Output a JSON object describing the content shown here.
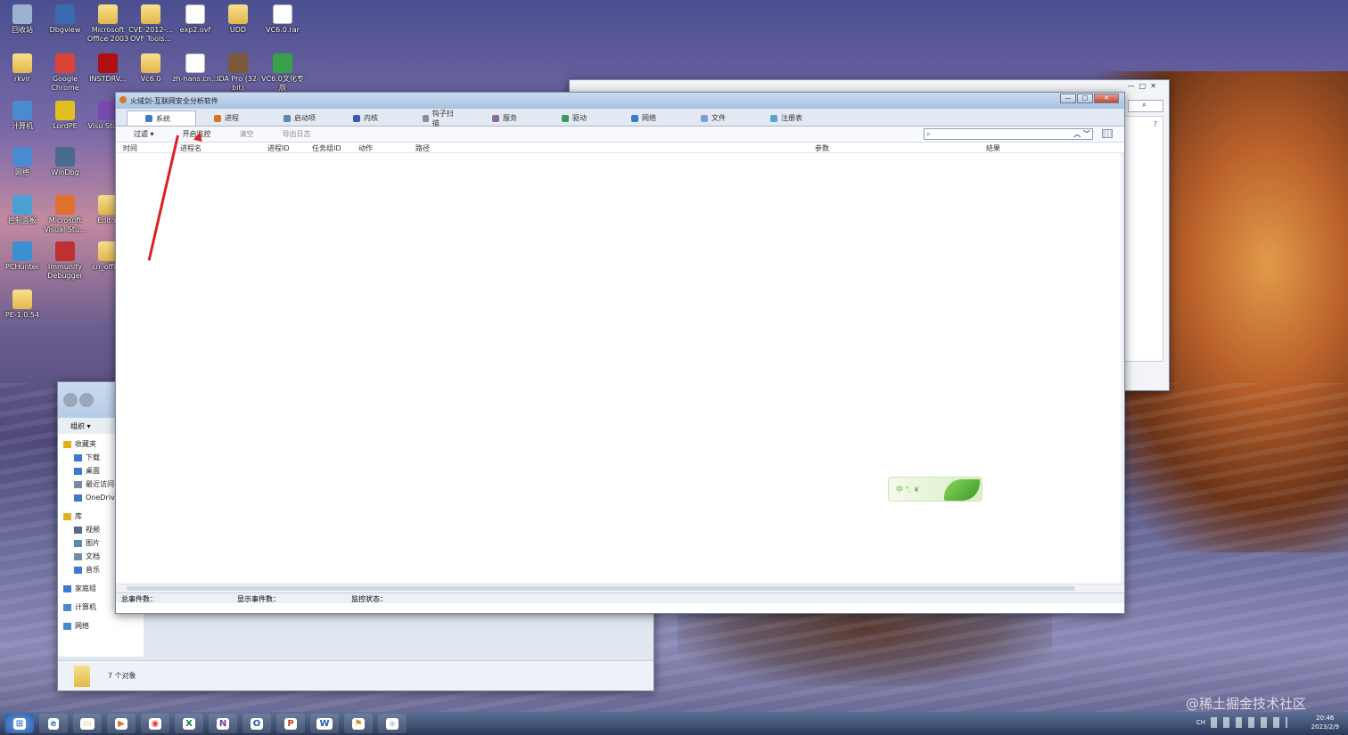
{
  "desktop": {
    "icons": [
      {
        "label": "回收站",
        "kind": "app",
        "color": "#9bb3d0"
      },
      {
        "label": "Dbgview",
        "kind": "app",
        "color": "#3a6ab0"
      },
      {
        "label": "Microsoft Office 2003",
        "kind": "folder",
        "color": "#e2b84a"
      },
      {
        "label": "CVE-2012-... OVF Tools...",
        "kind": "folder",
        "color": "#e2b84a"
      },
      {
        "label": "exp2.ovf",
        "kind": "file",
        "color": "#ffffff"
      },
      {
        "label": "UDD",
        "kind": "folder",
        "color": "#e2b84a"
      },
      {
        "label": "VC6.0.rar",
        "kind": "file",
        "color": "#ffffff"
      },
      {
        "label": "rkvir",
        "kind": "folder",
        "color": "#e2b84a"
      },
      {
        "label": "Google Chrome",
        "kind": "app",
        "color": "#db4437"
      },
      {
        "label": "INSTDRV...",
        "kind": "app",
        "color": "#b01010"
      },
      {
        "label": "Vc6.0",
        "kind": "folder",
        "color": "#e2b84a"
      },
      {
        "label": "zh-hans.cn...",
        "kind": "file",
        "color": "#ffffff"
      },
      {
        "label": "IDA Pro (32-bit)",
        "kind": "app",
        "color": "#7a5a3a"
      },
      {
        "label": "VC6.0文化专版",
        "kind": "app",
        "color": "#3aa04a"
      },
      {
        "label": "计算机",
        "kind": "app",
        "color": "#4a8ad0"
      },
      {
        "label": "LordPE",
        "kind": "app",
        "color": "#e0c020"
      },
      {
        "label": "Visu Studio",
        "kind": "app",
        "color": "#7a4ab0"
      },
      {
        "label": "网络",
        "kind": "app",
        "color": "#4a8ad0"
      },
      {
        "label": "WinDbg",
        "kind": "app",
        "color": "#4a6a90"
      },
      {
        "label": "控制面板",
        "kind": "app",
        "color": "#4aa0d0"
      },
      {
        "label": "Microsoft Visual Stu...",
        "kind": "app",
        "color": "#e07030"
      },
      {
        "label": "Editor",
        "kind": "folder",
        "color": "#e2b84a"
      },
      {
        "label": "PCHunter",
        "kind": "app",
        "color": "#3a90d0"
      },
      {
        "label": "Immunity Debugger",
        "kind": "app",
        "color": "#c03030"
      },
      {
        "label": "cn_office",
        "kind": "folder",
        "color": "#e2b84a"
      },
      {
        "label": "PE-1.0.54",
        "kind": "folder",
        "color": "#e2b84a"
      }
    ]
  },
  "main_window": {
    "title": "火绒剑-互联网安全分析软件",
    "buttons": {
      "min": "—",
      "max": "□",
      "close": "✕"
    },
    "tabs": [
      {
        "label": "系统",
        "color": "#3a7ad0"
      },
      {
        "label": "进程",
        "color": "#d07a20"
      },
      {
        "label": "启动项",
        "color": "#5a8ab0"
      },
      {
        "label": "内核",
        "color": "#3a5ab0"
      },
      {
        "label": "钩子扫描",
        "color": "#8a8aa0"
      },
      {
        "label": "服务",
        "color": "#8a6aa0"
      },
      {
        "label": "驱动",
        "color": "#3a9a5a"
      },
      {
        "label": "网络",
        "color": "#3a7ad0"
      },
      {
        "label": "文件",
        "color": "#7aa0d0"
      },
      {
        "label": "注册表",
        "color": "#5aa0d0"
      }
    ],
    "toolbar": {
      "filter": "过滤 ▾",
      "start_monitor": "开启监控",
      "clear": "清空",
      "export_log": "导出日志"
    },
    "columns": [
      "时间",
      "进程名",
      "进程ID",
      "任务组ID",
      "动作",
      "路径",
      "参数",
      "结果"
    ],
    "status": {
      "total": "总事件数：",
      "shown": "显示事件数：",
      "monitor": "监控状态："
    },
    "badge": {
      "label": "中 °, ❦"
    }
  },
  "explorer_window": {
    "organize": "组织 ▾",
    "sidebar": [
      {
        "label": "收藏夹",
        "color": "#e0b020"
      },
      {
        "label": "下载",
        "color": "#3a7ad0"
      },
      {
        "label": "桌面",
        "color": "#3a7ad0"
      },
      {
        "label": "最近访问",
        "color": "#7a8aa0"
      },
      {
        "label": "OneDrive",
        "color": "#3a7ad0"
      },
      {
        "label": "库",
        "color": "#e0b020"
      },
      {
        "label": "视频",
        "color": "#5a6a8a"
      },
      {
        "label": "图片",
        "color": "#5a8ab0"
      },
      {
        "label": "文档",
        "color": "#7a8aa0"
      },
      {
        "label": "音乐",
        "color": "#3a7ad0"
      },
      {
        "label": "家庭组",
        "color": "#3a7ad0"
      },
      {
        "label": "计算机",
        "color": "#4a8ad0"
      },
      {
        "label": "网络",
        "color": "#4a8ad0"
      }
    ],
    "footer": "7 个对象"
  },
  "taskbar": {
    "items": [
      {
        "label": "⊞",
        "color": "#3a7ad0"
      },
      {
        "label": "e",
        "color": "#2a8ad0"
      },
      {
        "label": "▭",
        "color": "#e2b84a"
      },
      {
        "label": "▶",
        "color": "#e07030"
      },
      {
        "label": "◉",
        "color": "#db4437"
      },
      {
        "label": "X",
        "color": "#1e7a3e"
      },
      {
        "label": "N",
        "color": "#7a3aa0"
      },
      {
        "label": "O",
        "color": "#1a5ab0"
      },
      {
        "label": "P",
        "color": "#c04020"
      },
      {
        "label": "W",
        "color": "#2a5ab0"
      },
      {
        "label": "⚑",
        "color": "#d08a20"
      },
      {
        "label": "◈",
        "color": "#c0c8d8"
      }
    ],
    "clock_time": "20:46",
    "clock_date": "2023/2/9",
    "tray_lang": "CH"
  },
  "watermark": "@稀土掘金技术社区"
}
